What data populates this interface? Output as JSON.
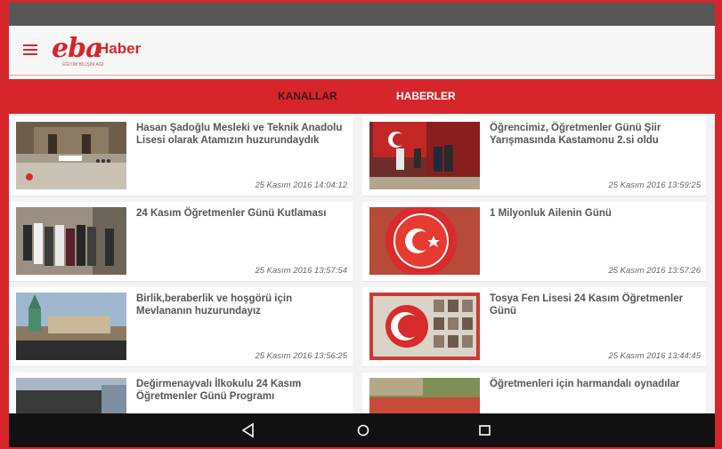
{
  "header": {
    "logo_text": "eba",
    "logo_subtext": "EĞİTİM BİLİŞİM AĞI",
    "title": "Haber"
  },
  "tabs": [
    {
      "label": "KANALLAR"
    },
    {
      "label": "HABERLER"
    }
  ],
  "news": [
    {
      "title": "Hasan Şadoğlu Mesleki ve Teknik Anadolu Lisesi olarak Atamızın huzurundaydık",
      "date": "25 Kasım 2016 14:04:12"
    },
    {
      "title": "Öğrencimiz, Öğretmenler Günü Şiir Yarışmasında Kastamonu 2.si oldu",
      "date": "25 Kasım 2016 13:59:25"
    },
    {
      "title": "24 Kasım Öğretmenler Günü Kutlaması",
      "date": "25 Kasım 2016 13:57:54"
    },
    {
      "title": "1 Milyonluk Ailenin Günü",
      "date": "25 Kasım 2016 13:57:26"
    },
    {
      "title": "Birlik,beraberlik ve hoşgörü için Mevlananın huzurundayız",
      "date": "25 Kasım 2016 13:56:25"
    },
    {
      "title": "Tosya Fen Lisesi 24 Kasım Öğretmenler Günü",
      "date": "25 Kasım 2016 13:44:45"
    },
    {
      "title": "Değirmenayvalı İlkokulu 24 Kasım Öğretmenler Günü Programı",
      "date": ""
    },
    {
      "title": "Öğretmenleri için harmandalı oynadılar",
      "date": ""
    }
  ],
  "navbar": {
    "back_icon": "back-triangle-icon",
    "home_icon": "home-circle-icon",
    "recent_icon": "recent-square-icon"
  }
}
